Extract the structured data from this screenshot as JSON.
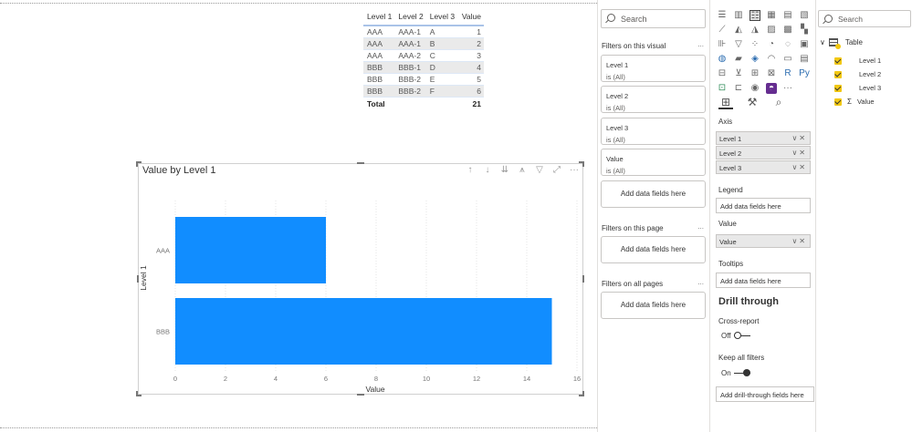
{
  "table_visual": {
    "headers": [
      "Level 1",
      "Level 2",
      "Level 3",
      "Value"
    ],
    "rows": [
      [
        "AAA",
        "AAA-1",
        "A",
        "1"
      ],
      [
        "AAA",
        "AAA-1",
        "B",
        "2"
      ],
      [
        "AAA",
        "AAA-2",
        "C",
        "3"
      ],
      [
        "BBB",
        "BBB-1",
        "D",
        "4"
      ],
      [
        "BBB",
        "BBB-2",
        "E",
        "5"
      ],
      [
        "BBB",
        "BBB-2",
        "F",
        "6"
      ]
    ],
    "total_label": "Total",
    "total_value": "21"
  },
  "chart_visual": {
    "title": "Value by Level 1",
    "tool_icons": [
      "drill-up-icon",
      "drill-down-icon",
      "expand-next-level-icon",
      "expand-all-icon",
      "filter-icon",
      "focus-mode-icon",
      "more-options-icon"
    ]
  },
  "chart_data": {
    "type": "bar",
    "orientation": "horizontal",
    "title": "Value by Level 1",
    "categories": [
      "AAA",
      "BBB"
    ],
    "values": [
      6,
      15
    ],
    "xlabel": "Value",
    "ylabel": "Level 1",
    "xlim": [
      0,
      16
    ],
    "xticks": [
      0,
      2,
      4,
      6,
      8,
      10,
      12,
      14,
      16
    ],
    "grid": true,
    "bar_color": "#118DFF"
  },
  "filters_pane": {
    "search_placeholder": "Search",
    "on_visual_label": "Filters on this visual",
    "on_visual_cards": [
      {
        "field": "Level 1",
        "state": "is (All)"
      },
      {
        "field": "Level 2",
        "state": "is (All)"
      },
      {
        "field": "Level 3",
        "state": "is (All)"
      },
      {
        "field": "Value",
        "state": "is (All)"
      }
    ],
    "add_fields": "Add data fields here",
    "on_page_label": "Filters on this page",
    "on_all_pages_label": "Filters on all pages",
    "more": "..."
  },
  "viz_pane": {
    "axis_label": "Axis",
    "axis_fields": [
      "Level 1",
      "Level 2",
      "Level 3"
    ],
    "legend_label": "Legend",
    "legend_add": "Add data fields here",
    "value_label": "Value",
    "value_fields": [
      "Value"
    ],
    "tooltips_label": "Tooltips",
    "tooltips_add": "Add data fields here",
    "drill_title": "Drill through",
    "cross_report_label": "Cross-report",
    "cross_report_state": "Off",
    "keep_filters_label": "Keep all filters",
    "keep_filters_state": "On",
    "drill_add": "Add drill-through fields here"
  },
  "fields_pane": {
    "search_placeholder": "Search",
    "table_name": "Table",
    "fields": [
      "Level 1",
      "Level 2",
      "Level 3",
      "Value"
    ],
    "sigma": "Σ"
  },
  "colors": {
    "accent": "#118DFF",
    "checkbox": "#F2C811"
  }
}
